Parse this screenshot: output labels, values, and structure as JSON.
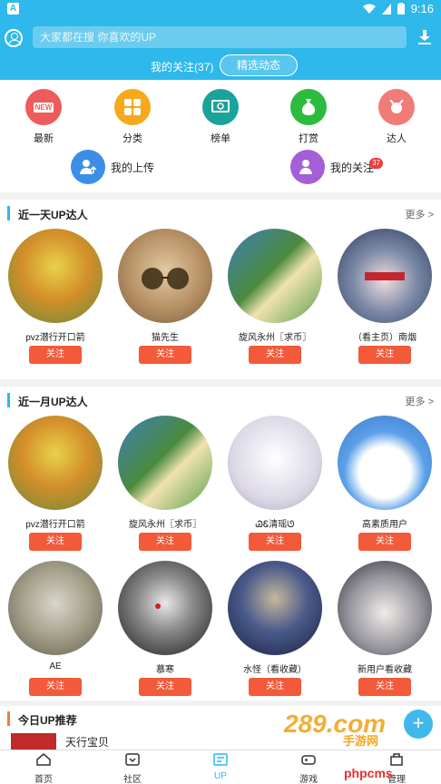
{
  "statusbar": {
    "time": "9:16"
  },
  "header": {
    "search_placeholder": "大家都在搜 你喜欢的UP",
    "follow_count": "我的关注(37)",
    "picked_label": "精选动态"
  },
  "categories": [
    {
      "label": "最新",
      "icon": "new-icon",
      "color": "#ef5a5a"
    },
    {
      "label": "分类",
      "icon": "grid-icon",
      "color": "#f7a91b"
    },
    {
      "label": "榜单",
      "icon": "certificate-icon",
      "color": "#1aa39a"
    },
    {
      "label": "打赏",
      "icon": "moneybag-icon",
      "color": "#2cbb3d"
    },
    {
      "label": "达人",
      "icon": "expert-icon",
      "color": "#f07c78"
    }
  ],
  "shortcuts": [
    {
      "label": "我的上传",
      "icon": "upload-user-icon",
      "color": "#3b8ee6"
    },
    {
      "label": "我的关注",
      "icon": "follow-user-icon",
      "color": "#a35ed8",
      "badge": "37"
    }
  ],
  "sections": [
    {
      "title": "近一天UP达人",
      "more": "更多 >",
      "users": [
        {
          "name": "pvz潜行开口箭",
          "follow": "关注",
          "color": "#9a7b2a"
        },
        {
          "name": "猫先生",
          "follow": "关注",
          "color": "#b58f63"
        },
        {
          "name": "旋风永州〖求币〗",
          "follow": "关注",
          "color": "#4a8a3d"
        },
        {
          "name": "（看主页）南烟",
          "follow": "关注",
          "color": "#2b3a5a"
        }
      ]
    },
    {
      "title": "近一月UP达人",
      "more": "更多 >",
      "users": [
        {
          "name": "pvz潜行开口箭",
          "follow": "关注",
          "color": "#9a7b2a"
        },
        {
          "name": "旋风永州〖求币〗",
          "follow": "关注",
          "color": "#4a8a3d"
        },
        {
          "name": "ᏊᏋ清瑶ᘎ",
          "follow": "关注",
          "color": "#dcd8e6"
        },
        {
          "name": "高素质用户",
          "follow": "关注",
          "color": "#5aa0e8"
        },
        {
          "name": "AE",
          "follow": "关注",
          "color": "#7a7860"
        },
        {
          "name": "慕寒",
          "follow": "关注",
          "color": "#333333"
        },
        {
          "name": "水怪（看收藏）",
          "follow": "关注",
          "color": "#2a3050"
        },
        {
          "name": "新用户看收藏",
          "follow": "关注",
          "color": "#6a6a72"
        }
      ]
    }
  ],
  "today": {
    "title": "今日UP推荐",
    "item": "天行宝贝"
  },
  "tabs": [
    {
      "label": "首页",
      "icon": "home-icon"
    },
    {
      "label": "社区",
      "icon": "community-icon"
    },
    {
      "label": "UP",
      "icon": "up-icon"
    },
    {
      "label": "游戏",
      "icon": "gamepad-icon"
    },
    {
      "label": "管理",
      "icon": "manage-icon"
    }
  ],
  "watermark": {
    "brand": "289.com",
    "sub": "手游网",
    "site": "phpcms"
  },
  "accent": "#2fb8eb",
  "follow_color": "#f25a3a"
}
